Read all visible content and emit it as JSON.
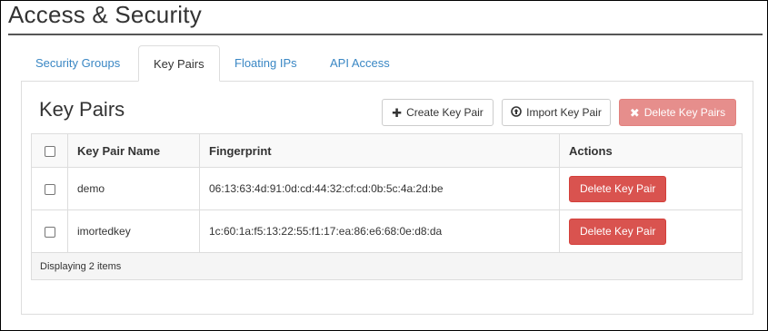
{
  "page": {
    "title": "Access & Security"
  },
  "tabs": [
    {
      "label": "Security Groups",
      "active": false
    },
    {
      "label": "Key Pairs",
      "active": true
    },
    {
      "label": "Floating IPs",
      "active": false
    },
    {
      "label": "API Access",
      "active": false
    }
  ],
  "panel": {
    "title": "Key Pairs"
  },
  "toolbar": {
    "create_label": "Create Key Pair",
    "import_label": "Import Key Pair",
    "delete_label": "Delete Key Pairs"
  },
  "table": {
    "headers": {
      "name": "Key Pair Name",
      "fingerprint": "Fingerprint",
      "actions": "Actions"
    },
    "rows": [
      {
        "name": "demo",
        "fingerprint": "06:13:63:4d:91:0d:cd:44:32:cf:cd:0b:5c:4a:2d:be",
        "action": "Delete Key Pair"
      },
      {
        "name": "imortedkey",
        "fingerprint": "1c:60:1a:f5:13:22:55:f1:17:ea:86:e6:68:0e:d8:da",
        "action": "Delete Key Pair"
      }
    ],
    "footer": "Displaying 2 items"
  },
  "colors": {
    "link": "#3a87c4",
    "danger": "#d9534f"
  }
}
